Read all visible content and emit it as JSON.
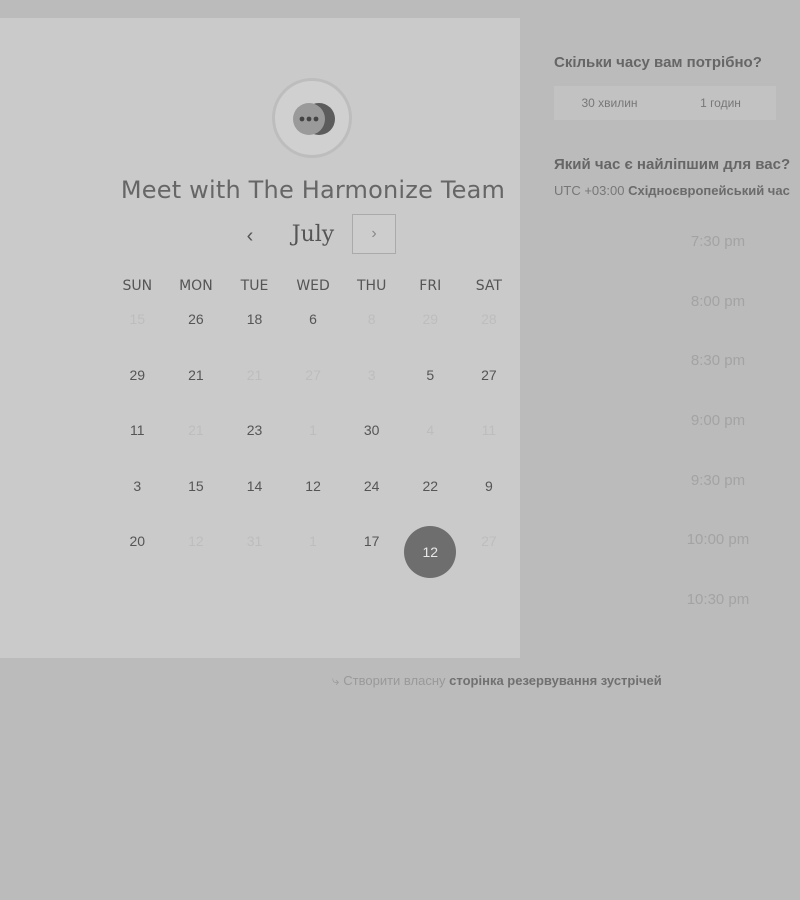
{
  "header": {
    "title": "Meet with The Harmonize Team",
    "month": "July",
    "prev_icon": "‹",
    "next_icon": "›"
  },
  "calendar": {
    "weekdays": [
      "SUN",
      "MON",
      "TUE",
      "WED",
      "THU",
      "FRI",
      "SAT"
    ],
    "weeks": [
      [
        {
          "d": "15",
          "m": true
        },
        {
          "d": "26"
        },
        {
          "d": "18"
        },
        {
          "d": "6"
        },
        {
          "d": "8",
          "m": true
        },
        {
          "d": "29",
          "m": true
        },
        {
          "d": "28",
          "m": true
        }
      ],
      [
        {
          "d": "29"
        },
        {
          "d": "21"
        },
        {
          "d": "21",
          "m": true
        },
        {
          "d": "27",
          "m": true
        },
        {
          "d": "3",
          "m": true
        },
        {
          "d": "5"
        },
        {
          "d": "27"
        }
      ],
      [
        {
          "d": "11"
        },
        {
          "d": "21",
          "m": true
        },
        {
          "d": "23"
        },
        {
          "d": "1",
          "m": true
        },
        {
          "d": "30"
        },
        {
          "d": "4",
          "m": true
        },
        {
          "d": "11",
          "m": true
        }
      ],
      [
        {
          "d": "3"
        },
        {
          "d": "15"
        },
        {
          "d": "14"
        },
        {
          "d": "12"
        },
        {
          "d": "24"
        },
        {
          "d": "22"
        },
        {
          "d": "9"
        }
      ],
      [
        {
          "d": "20"
        },
        {
          "d": "12",
          "m": true
        },
        {
          "d": "31",
          "m": true
        },
        {
          "d": "1",
          "m": true
        },
        {
          "d": "17"
        },
        {
          "d": "12",
          "sel": true
        },
        {
          "d": "27",
          "m": true
        }
      ]
    ]
  },
  "panel": {
    "duration_question": "Скільки часу вам потрібно?",
    "durations": [
      "30 хвилин",
      "1 годин"
    ],
    "time_question": "Який час є найліпшим для вас?",
    "tz_offset": "UTC +03:00",
    "tz_name": "Східноєвропейський час",
    "slots": [
      "7:30 pm",
      "8:00 pm",
      "8:30 pm",
      "9:00 pm",
      "9:30 pm",
      "10:00 pm",
      "10:30 pm"
    ]
  },
  "footer": {
    "icon": "link-icon",
    "prefix": "Створити власну",
    "link": "сторінка резервування зустрічей"
  }
}
